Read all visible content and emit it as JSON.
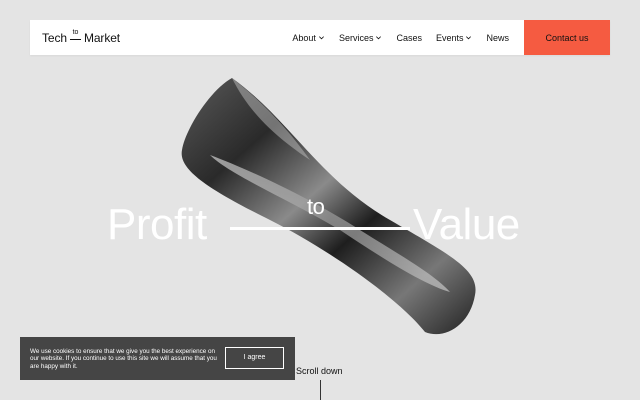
{
  "header": {
    "logo": {
      "left": "Tech",
      "middle": "to",
      "right": "Market"
    },
    "nav": [
      {
        "label": "About",
        "has_dropdown": true
      },
      {
        "label": "Services",
        "has_dropdown": true
      },
      {
        "label": "Cases",
        "has_dropdown": false
      },
      {
        "label": "Events",
        "has_dropdown": true
      },
      {
        "label": "News",
        "has_dropdown": false
      }
    ],
    "contact_label": "Contact us"
  },
  "hero": {
    "word_left": "Profit",
    "word_middle": "to",
    "word_right": "Value"
  },
  "cookie": {
    "text": "We use cookies to ensure that we give you the best experience on our website. If you continue to use this site we will assume that you are happy with it.",
    "button_label": "I agree"
  },
  "scroll_label": "Scroll down",
  "colors": {
    "background": "#e4e4e4",
    "accent": "#f55b41",
    "cookie_bg": "#454545"
  }
}
